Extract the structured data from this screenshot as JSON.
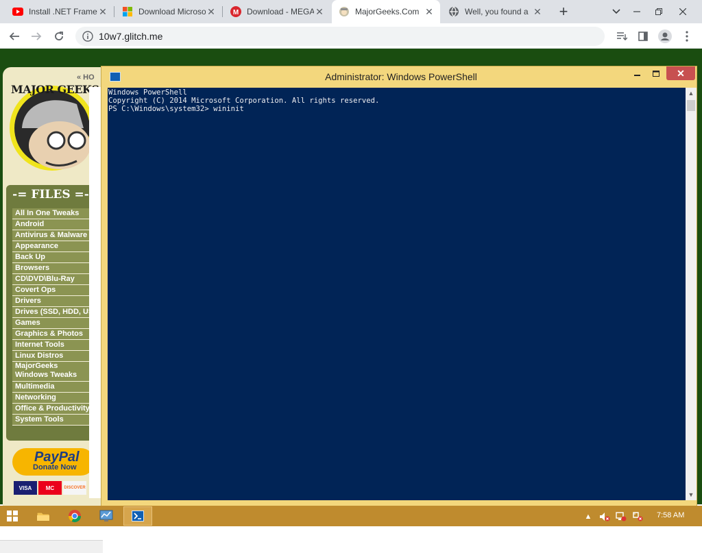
{
  "browser": {
    "tabs": [
      {
        "title": "Install .NET Framew",
        "icon": "youtube-icon",
        "active": false
      },
      {
        "title": "Download Microso",
        "icon": "microsoft-icon",
        "active": false
      },
      {
        "title": "Download - MEGA",
        "icon": "mega-icon",
        "active": false
      },
      {
        "title": "MajorGeeks.Com",
        "icon": "majorgeeks-icon",
        "active": true
      },
      {
        "title": "Well, you found a",
        "icon": "globe-icon",
        "active": false
      }
    ],
    "new_tab_label": "+",
    "url": "10w7.glitch.me"
  },
  "website": {
    "logo_text": "MAJOR GEEKS",
    "home_link": "« HO",
    "files_title": "-= FILES =-",
    "categories": [
      "All In One Tweaks",
      "Android",
      "Antivirus & Malware",
      "Appearance",
      "Back Up",
      "Browsers",
      "CD\\DVD\\Blu-Ray",
      "Covert Ops",
      "Drivers",
      "Drives (SSD, HDD, USB)",
      "Games",
      "Graphics & Photos",
      "Internet Tools",
      "Linux Distros",
      "MajorGeeks Windows Tweaks",
      "Multimedia",
      "Networking",
      "Office & Productivity",
      "System Tools"
    ],
    "paypal": {
      "brand": "PayPal",
      "cta": "Donate Now"
    },
    "cards": [
      "VISA",
      "MC",
      "DISCOVER"
    ]
  },
  "powershell": {
    "title": "Administrator: Windows PowerShell",
    "lines": [
      "Windows PowerShell",
      "Copyright (C) 2014 Microsoft Corporation. All rights reserved.",
      "",
      "PS C:\\Windows\\system32> wininit"
    ]
  },
  "taskbar": {
    "apps": [
      "file-explorer-icon",
      "chrome-icon",
      "control-panel-icon",
      "powershell-icon"
    ],
    "clock": "7:58 AM"
  }
}
